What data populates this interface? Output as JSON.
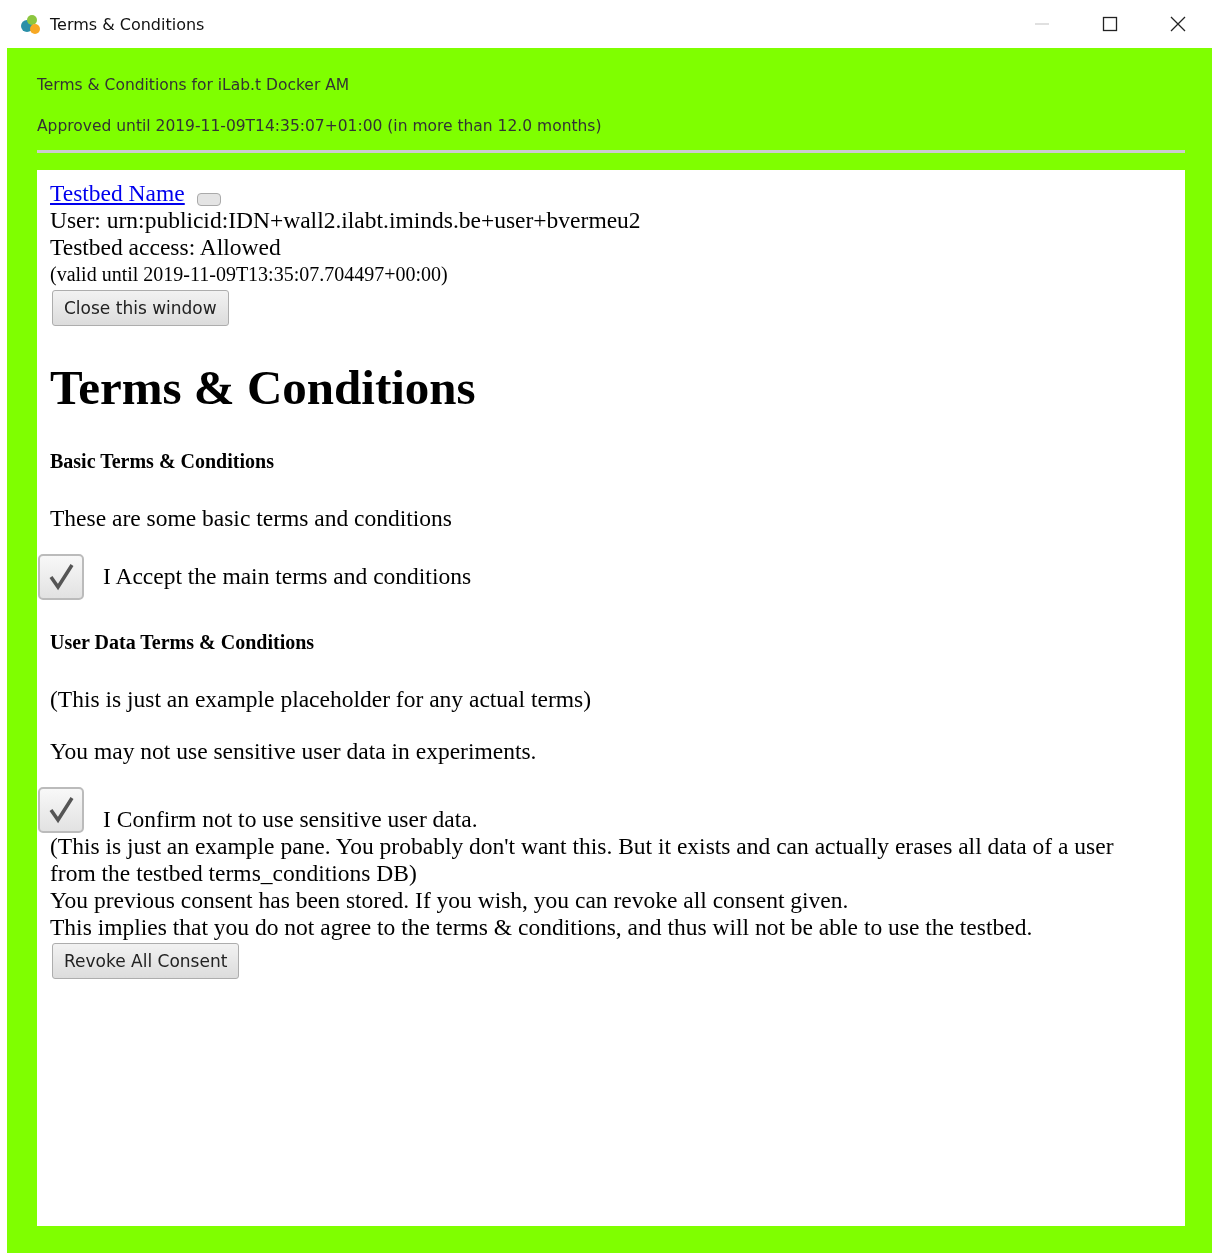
{
  "window": {
    "title": "Terms & Conditions",
    "controls": [
      {
        "kind": "minimize",
        "disabled": true
      },
      {
        "kind": "maximize",
        "disabled": false
      },
      {
        "kind": "close",
        "disabled": false
      }
    ]
  },
  "header": {
    "title": "Terms & Conditions for iLab.t Docker AM",
    "approved": "Approved until 2019-11-09T14:35:07+01:00 (in more than 12.0 months)"
  },
  "testbed": {
    "link": "Testbed Name",
    "user": "User: urn:publicid:IDN+wall2.ilabt.iminds.be+user+bvermeu2",
    "access": "Testbed access: Allowed",
    "valid": "(valid until 2019-11-09T13:35:07.704497+00:00)",
    "close_button": "Close this window"
  },
  "heading": "Terms & Conditions",
  "sections": [
    {
      "title": "Basic Terms & Conditions",
      "paragraphs": [
        "These are some basic terms and conditions"
      ],
      "checkbox": {
        "label": "I Accept the main terms and conditions",
        "checked": true
      }
    },
    {
      "title": "User Data Terms & Conditions",
      "paragraphs": [
        "(This is just an example placeholder for any actual terms)",
        "You may not use sensitive user data in experiments."
      ],
      "checkbox": {
        "label": "I Confirm not to use sensitive user data.",
        "checked": true
      }
    }
  ],
  "notes": [
    "(This is just an example pane. You probably don't want this. But it exists and can actually erases all data of a user from the testbed terms_conditions DB)",
    "You previous consent has been stored. If you wish, you can revoke all consent given.",
    "This implies that you do not agree to the terms & conditions, and thus will not be able to use the testbed."
  ],
  "revoke_button": "Revoke All Consent"
}
